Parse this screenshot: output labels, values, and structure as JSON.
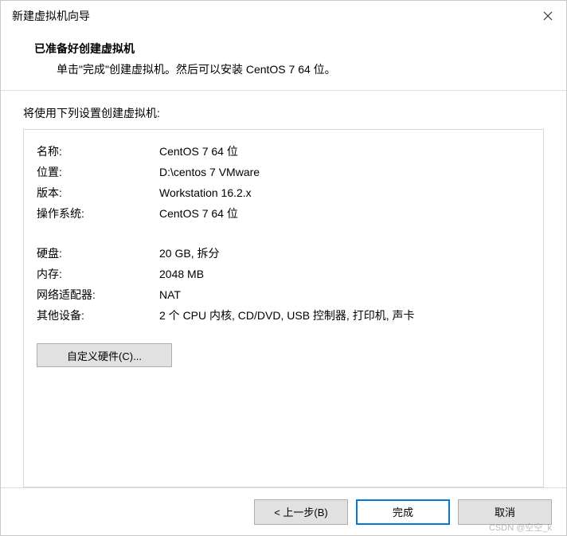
{
  "window": {
    "title": "新建虚拟机向导"
  },
  "header": {
    "title": "已准备好创建虚拟机",
    "subtitle": "单击\"完成\"创建虚拟机。然后可以安装 CentOS 7 64 位。"
  },
  "content": {
    "label": "将使用下列设置创建虚拟机:",
    "rows": [
      {
        "key": "名称:",
        "val": "CentOS 7 64 位"
      },
      {
        "key": "位置:",
        "val": "D:\\centos 7 VMware"
      },
      {
        "key": "版本:",
        "val": "Workstation 16.2.x"
      },
      {
        "key": "操作系统:",
        "val": "CentOS 7 64 位"
      }
    ],
    "rows2": [
      {
        "key": "硬盘:",
        "val": "20 GB, 拆分"
      },
      {
        "key": "内存:",
        "val": "2048 MB"
      },
      {
        "key": "网络适配器:",
        "val": "NAT"
      },
      {
        "key": "其他设备:",
        "val": "2 个 CPU 内核, CD/DVD, USB 控制器, 打印机, 声卡"
      }
    ],
    "customize_label": "自定义硬件(C)..."
  },
  "footer": {
    "back": "< 上一步(B)",
    "finish": "完成",
    "cancel": "取消"
  },
  "watermark": "CSDN @空空_k"
}
